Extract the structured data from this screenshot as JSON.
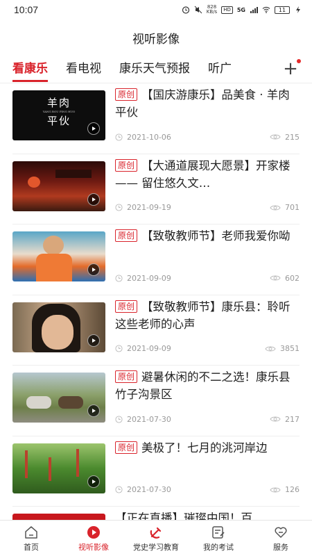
{
  "status_bar": {
    "time": "10:07",
    "speed": "828\nKB/s",
    "hd": "HD",
    "net": "5G",
    "battery": "11"
  },
  "header": {
    "title": "视听影像"
  },
  "tabs": [
    {
      "label": "看康乐",
      "active": true
    },
    {
      "label": "看电视",
      "active": false
    },
    {
      "label": "康乐天气预报",
      "active": false
    },
    {
      "label": "听广",
      "active": false
    }
  ],
  "add_tab": "+",
  "tag_label": "原创",
  "items": [
    {
      "tag": "原创",
      "title": "【国庆游康乐】品美食 · 羊肉平伙",
      "date": "2021-10-06",
      "views": "215",
      "thumb_text": "羊肉平伙",
      "thumb_sub": "YANG ROU PING HUO"
    },
    {
      "tag": "原创",
      "title": "【大通道展现大愿景】开家楼 —— 留住悠久文…",
      "date": "2021-09-19",
      "views": "701"
    },
    {
      "tag": "原创",
      "title": "【致敬教师节】老师我爱你呦",
      "date": "2021-09-09",
      "views": "602"
    },
    {
      "tag": "原创",
      "title": "【致敬教师节】康乐县：聆听这些老师的心声",
      "date": "2021-09-09",
      "views": "3851"
    },
    {
      "tag": "原创",
      "title": "避暑休闲的不二之选！康乐县竹子沟景区",
      "date": "2021-07-30",
      "views": "217"
    },
    {
      "tag": "原创",
      "title": "美极了！七月的洮河岸边",
      "date": "2021-07-30",
      "views": "126"
    },
    {
      "tag": "",
      "title": "【正在直播】璀璨中国！百",
      "date": "",
      "views": ""
    }
  ],
  "bottom_nav": [
    {
      "label": "首页",
      "icon": "home-icon",
      "active": false
    },
    {
      "label": "视听影像",
      "icon": "play-circle-icon",
      "active": true
    },
    {
      "label": "党史学习教育",
      "icon": "party-emblem-icon",
      "active": false
    },
    {
      "label": "我的考试",
      "icon": "exam-edit-icon",
      "active": false
    },
    {
      "label": "服务",
      "icon": "heart-service-icon",
      "active": false
    }
  ],
  "colors": {
    "accent": "#d9232b",
    "meta": "#999999",
    "divider": "#eeeeee"
  }
}
